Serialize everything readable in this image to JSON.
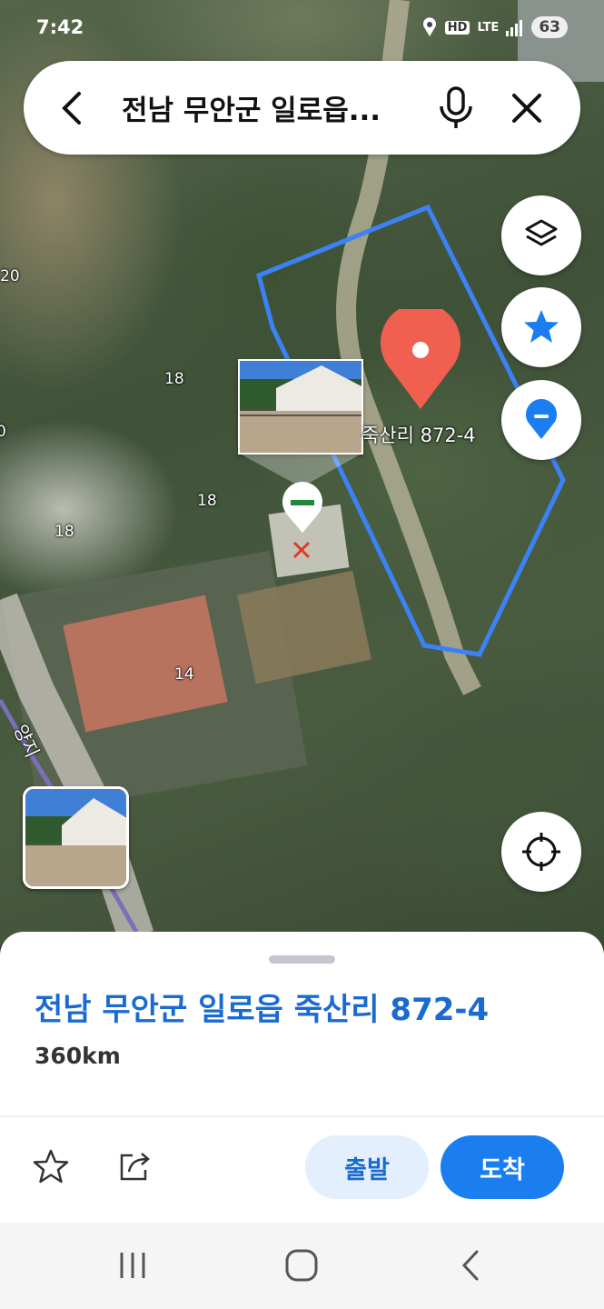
{
  "status_bar": {
    "time": "7:42",
    "network": "LTE",
    "hd_voice": "HD",
    "battery": "63"
  },
  "search": {
    "query": "전남 무안군 일로읍...",
    "back_icon": "back-arrow-icon",
    "mic_icon": "microphone-icon",
    "clear_icon": "close-icon"
  },
  "map": {
    "elevations": [
      "20",
      "18",
      "0",
      "18",
      "18",
      "14"
    ],
    "road_label": "양지",
    "place_label": "죽산리 872-4",
    "marker_color": "#f05f4f",
    "boundary_color": "#3b82f6"
  },
  "fabs": {
    "layers_icon": "layers-icon",
    "favorites_icon": "star-icon",
    "pin_icon": "location-pin-icon",
    "locate_icon": "crosshair-icon",
    "accent": "#1a7ef0"
  },
  "sheet": {
    "address": "전남 무안군 일로읍 죽산리 872-4",
    "distance": "360km",
    "depart_label": "출발",
    "arrive_label": "도착",
    "save_icon": "star-outline-icon",
    "share_icon": "share-icon"
  },
  "navbar": {
    "recent_icon": "recent-apps-icon",
    "home_icon": "home-icon",
    "back_icon": "back-icon"
  }
}
